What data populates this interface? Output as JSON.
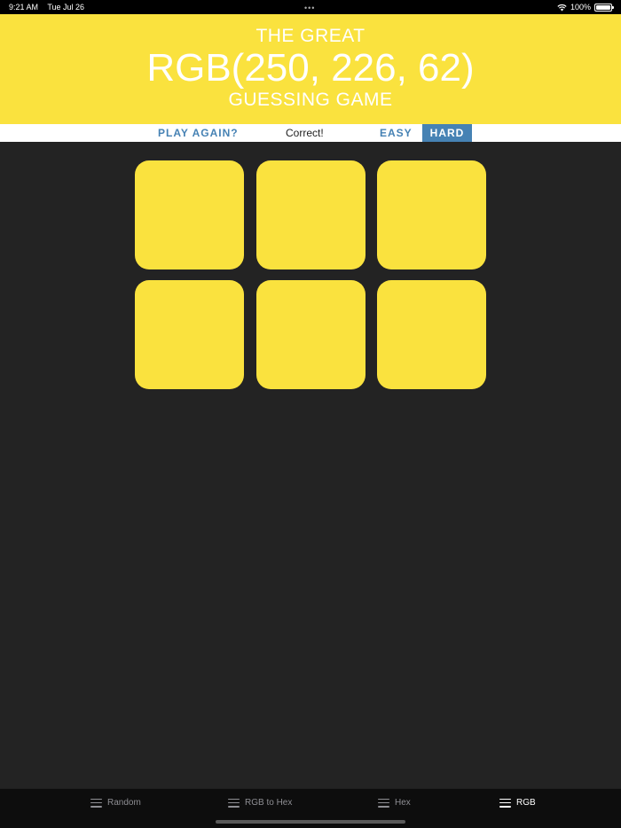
{
  "status_bar": {
    "time": "9:21 AM",
    "date": "Tue Jul 26",
    "battery": "100%",
    "wifi_icon": "wifi-icon",
    "battery_icon": "battery-icon"
  },
  "header": {
    "line_top": "THE GREAT",
    "rgb_text": "RGB(250, 226, 62)",
    "line_bottom": "GUESSING GAME",
    "background_color": "#fae23e"
  },
  "controls": {
    "play_again": "PLAY AGAIN?",
    "message": "Correct!",
    "easy": "EASY",
    "hard": "HARD",
    "selected_mode": "HARD",
    "accent_color": "#4682b4"
  },
  "board": {
    "squares": [
      {
        "color": "#fae23e"
      },
      {
        "color": "#fae23e"
      },
      {
        "color": "#fae23e"
      },
      {
        "color": "#fae23e"
      },
      {
        "color": "#fae23e"
      },
      {
        "color": "#fae23e"
      }
    ]
  },
  "tab_bar": {
    "tabs": [
      {
        "label": "Random",
        "icon": "hamburger-icon",
        "active": false
      },
      {
        "label": "RGB to Hex",
        "icon": "hamburger-icon",
        "active": false
      },
      {
        "label": "Hex",
        "icon": "hamburger-icon",
        "active": false
      },
      {
        "label": "RGB",
        "icon": "hamburger-icon",
        "active": true
      }
    ]
  }
}
